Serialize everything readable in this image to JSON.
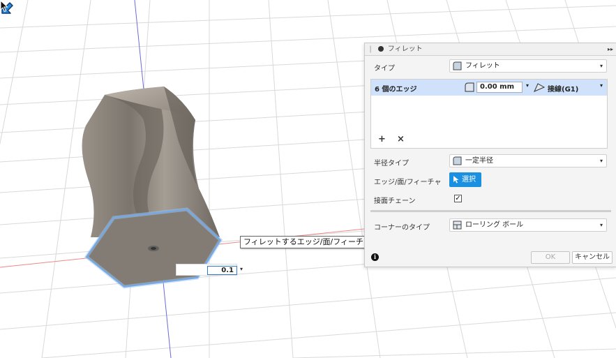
{
  "panel": {
    "title": "フィレット",
    "type_label": "タイプ",
    "type_value": "フィレット",
    "edge_count_label": "6 個のエッジ",
    "radius_value": "0.00 mm",
    "tangency_value": "接線(G1)",
    "add_symbol": "+",
    "remove_symbol": "×",
    "radius_type_label": "半径タイプ",
    "radius_type_value": "一定半径",
    "selection_label": "エッジ/面/フィーチャ",
    "selection_button": "選択",
    "tangent_chain_label": "接面チェーン",
    "tangent_chain_checked": "✓",
    "corner_type_label": "コーナーのタイプ",
    "corner_type_value": "ローリング ボール",
    "info_symbol": "i",
    "ok_label": "OK",
    "cancel_label": "キャンセル"
  },
  "tooltip": "フィレットするエッジ/面/フィーチャを選択",
  "canvas_input": {
    "value": "0.1"
  },
  "icons": {
    "panel_dot": "fillet-dot-icon",
    "type": "fillet-type-icon",
    "radius": "radius-icon",
    "tangency": "tangent-g1-icon",
    "radius_type": "constant-radius-icon",
    "select": "cursor-arrow-icon",
    "corner": "rolling-ball-icon",
    "info": "info-icon",
    "manipulator": "drag-arrow-icon"
  },
  "colors": {
    "accent": "#1b8fe0",
    "selection_row": "#cfe1fb",
    "edge_highlight": "#4a90e2",
    "body_shade": "#8a8379"
  }
}
